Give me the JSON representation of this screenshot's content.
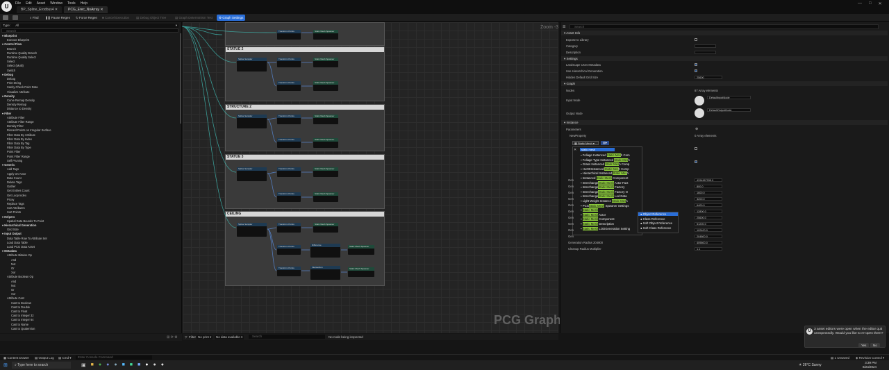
{
  "window": {
    "logo": "U",
    "menu": [
      "File",
      "Edit",
      "Asset",
      "Window",
      "Tools",
      "Help"
    ],
    "tabs": [
      "BP_Spline_Erodbus4",
      "PCG_Erec_NoArray"
    ],
    "window_controls": [
      "—",
      "□",
      "✕"
    ]
  },
  "toolbar": {
    "buttons": [
      "Find",
      "Pause Regen",
      "Force Regen",
      "Cancel Execution",
      "Debug Object Tree",
      "Graph Determinism Test"
    ],
    "graph_settings": "Graph Settings"
  },
  "palette": {
    "type_label": "Type",
    "type_value": "All",
    "search_placeholder": "Search",
    "tree": [
      {
        "t": "Blueprint",
        "l": 0
      },
      {
        "t": "Execute Blueprint",
        "l": 1
      },
      {
        "t": "Control Flow",
        "l": 0
      },
      {
        "t": "Branch",
        "l": 1
      },
      {
        "t": "Runtime Quality Branch",
        "l": 1
      },
      {
        "t": "Runtime Quality Select",
        "l": 1
      },
      {
        "t": "Select",
        "l": 1
      },
      {
        "t": "Select (Multi)",
        "l": 1
      },
      {
        "t": "Switch",
        "l": 1
      },
      {
        "t": "Debug",
        "l": 0
      },
      {
        "t": "Debug",
        "l": 1
      },
      {
        "t": "Print String",
        "l": 1
      },
      {
        "t": "Sanity Check Point Data",
        "l": 1
      },
      {
        "t": "Visualize Attribute",
        "l": 1
      },
      {
        "t": "Density",
        "l": 0
      },
      {
        "t": "Curve Remap Density",
        "l": 1
      },
      {
        "t": "Density Remap",
        "l": 1
      },
      {
        "t": "Distance to Density",
        "l": 1
      },
      {
        "t": "Filter",
        "l": 0
      },
      {
        "t": "Attribute Filter",
        "l": 1
      },
      {
        "t": "Attribute Filter Range",
        "l": 1
      },
      {
        "t": "Density Filter",
        "l": 1
      },
      {
        "t": "Discard Points on Irregular Surface",
        "l": 1
      },
      {
        "t": "Filter Data By Attribute",
        "l": 1
      },
      {
        "t": "Filter Data By Index",
        "l": 1
      },
      {
        "t": "Filter Data By Tag",
        "l": 1
      },
      {
        "t": "Filter Data By Type",
        "l": 1
      },
      {
        "t": "Point Filter",
        "l": 1
      },
      {
        "t": "Point Filter Range",
        "l": 1
      },
      {
        "t": "Self Pruning",
        "l": 1
      },
      {
        "t": "Generic",
        "l": 0
      },
      {
        "t": "Add Tags",
        "l": 1
      },
      {
        "t": "Apply On Actor",
        "l": 1
      },
      {
        "t": "Data Count",
        "l": 1
      },
      {
        "t": "Delete Tags",
        "l": 1
      },
      {
        "t": "Gather",
        "l": 1
      },
      {
        "t": "Get Entries Count",
        "l": 1
      },
      {
        "t": "Get Loop Index",
        "l": 1
      },
      {
        "t": "Proxy",
        "l": 1
      },
      {
        "t": "Replace Tags",
        "l": 1
      },
      {
        "t": "Sort Attributes",
        "l": 1
      },
      {
        "t": "Sort Points",
        "l": 1
      },
      {
        "t": "Helpers",
        "l": 0
      },
      {
        "t": "Spatial Data Bounds To Point",
        "l": 1
      },
      {
        "t": "Hierarchical Generation",
        "l": 0
      },
      {
        "t": "Grid Size",
        "l": 1
      },
      {
        "t": "Input Output",
        "l": 0
      },
      {
        "t": "Data Table Row To Attribute Set",
        "l": 1
      },
      {
        "t": "Load Data Table",
        "l": 1
      },
      {
        "t": "Load PCG Data Asset",
        "l": 1
      },
      {
        "t": "Metadata",
        "l": 0
      },
      {
        "t": "Attribute Bitwise Op",
        "l": 1
      },
      {
        "t": "And",
        "l": 2
      },
      {
        "t": "Not",
        "l": 2
      },
      {
        "t": "Or",
        "l": 2
      },
      {
        "t": "Xor",
        "l": 2
      },
      {
        "t": "Attribute Boolean Op",
        "l": 1
      },
      {
        "t": "And",
        "l": 2
      },
      {
        "t": "Not",
        "l": 2
      },
      {
        "t": "Or",
        "l": 2
      },
      {
        "t": "Xor",
        "l": 2
      },
      {
        "t": "Attribute Cast",
        "l": 1
      },
      {
        "t": "Cast to Boolean",
        "l": 2
      },
      {
        "t": "Cast to Double",
        "l": 2
      },
      {
        "t": "Cast to Float",
        "l": 2
      },
      {
        "t": "Cast to Integer 32",
        "l": 2
      },
      {
        "t": "Cast to Integer 64",
        "l": 2
      },
      {
        "t": "Cast to Name",
        "l": 2
      },
      {
        "t": "Cast to Quaternion",
        "l": 2
      }
    ]
  },
  "graph": {
    "zoom": "Zoom -3",
    "watermark": "PCG Graph",
    "comments": [
      "STATUE 2",
      "STRUCTURE 2",
      "STATUE 3",
      "CEILING"
    ],
    "node_titles": {
      "spline": "Spline Sampler",
      "transform": "Transform Points",
      "spawner": "Static Mesh Spawner",
      "spline_sub": "Spline",
      "sub2": "Ascending Shape",
      "diff": "Difference",
      "intersect": "Intersection"
    }
  },
  "graph_bottom": {
    "filter": "Filter",
    "print": "No print",
    "no_data": "No data available",
    "search_placeholder": "Search",
    "no_node": "No node being inspected"
  },
  "details": {
    "search_placeholder": "Search",
    "sections": {
      "asset_info": "Asset Info",
      "settings": "Settings",
      "graph": "Graph",
      "instance": "Instance"
    },
    "asset_info": [
      {
        "label": "Expose to Library",
        "value": ""
      },
      {
        "label": "Category",
        "value": ""
      },
      {
        "label": "Description",
        "value": ""
      }
    ],
    "settings": [
      {
        "label": "Landscape Uses Metadata",
        "value": ""
      },
      {
        "label": "Use Hierarchical Generation",
        "value": ""
      },
      {
        "label": "Hidden Default Grid Size",
        "value": "25600"
      }
    ],
    "graph": [
      {
        "label": "Nodes",
        "value": "87 Array elements"
      },
      {
        "label": "Input Node",
        "value": "DefaultInputNode"
      },
      {
        "label": "Output Node",
        "value": "DefaultOutputNode"
      }
    ],
    "instance": [
      {
        "label": "Parameters",
        "value": ""
      },
      {
        "label": "NewProperty",
        "value": "0 Array elements"
      }
    ],
    "picker": {
      "label": "Static Mesh",
      "search": "static mesh"
    },
    "numeric": [
      {
        "label": "Gen",
        "value": "4294967295.0"
      },
      {
        "label": "Gen",
        "value": "800.0"
      },
      {
        "label": "Gen",
        "value": "1600.0"
      },
      {
        "label": "Gen",
        "value": "3200.0"
      },
      {
        "label": "Gen",
        "value": "6400.0"
      },
      {
        "label": "Gen",
        "value": "12800.0"
      },
      {
        "label": "Gen",
        "value": "25600.0"
      },
      {
        "label": "Gen",
        "value": "51200.0"
      },
      {
        "label": "Gen",
        "value": "102400.0"
      },
      {
        "label": "Gen",
        "value": "204800.0"
      },
      {
        "label": "Generation Radius 204800",
        "value": "409600.0"
      },
      {
        "label": "Cleanup Radius Multiplier",
        "value": "1.1"
      }
    ]
  },
  "type_popup": {
    "items": [
      {
        "pre": "Foliage Instanced ",
        "hl": "Static Mes",
        "post": "h Com"
      },
      {
        "pre": "Foliage Type Instanced ",
        "hl": "Static Mes",
        "post": "h"
      },
      {
        "pre": "Grass Instanced ",
        "hl": "Static Mes",
        "post": "h Comp"
      },
      {
        "pre": "HLODInstanced ",
        "hl": "Static Mes",
        "post": "h Comp"
      },
      {
        "pre": "Hierarchical Instanced ",
        "hl": "Static Mes",
        "post": "h"
      },
      {
        "pre": "Instanced ",
        "hl": "Static Mesh",
        "post": " Component"
      },
      {
        "pre": "Interchange",
        "hl": "Static Mesh",
        "post": " Actor Fact"
      },
      {
        "pre": "Interchange",
        "hl": "Static Mesh",
        "post": " Factory"
      },
      {
        "pre": "Interchange",
        "hl": "Static Mesh",
        "post": " Factory N"
      },
      {
        "pre": "Interchange",
        "hl": "Static Mesh",
        "post": " Lod Data"
      },
      {
        "pre": "Light Weight Instance ",
        "hl": "Static Mes",
        "post": "h"
      },
      {
        "pre": "PCG",
        "hl": "Static Mesh",
        "post": " Spawner Settings"
      },
      {
        "pre": "",
        "hl": "Static Mesh",
        "post": ""
      },
      {
        "pre": "",
        "hl": "Static Mesh",
        "post": " Actor"
      },
      {
        "pre": "",
        "hl": "Static Mesh",
        "post": " Component"
      },
      {
        "pre": "",
        "hl": "Static Mesh",
        "post": " Description"
      },
      {
        "pre": "",
        "hl": "Static Mesh",
        "post": " LODGeneration Setting"
      }
    ],
    "submenu": [
      "Object Reference",
      "Class Reference",
      "Soft Object Reference",
      "Soft Class Reference"
    ]
  },
  "bottom": {
    "content_drawer": "Content Drawer",
    "output_log": "Output Log",
    "cmd": "Cmd",
    "console_placeholder": "Enter Console Command",
    "unsaved": "1 Unsaved",
    "revision": "Revision Control"
  },
  "toast": {
    "message": "3 asset editors were open when the editor quit unexpectedly. Would you like to re-open them?",
    "yes": "Yes",
    "no": "No"
  },
  "taskbar": {
    "search": "Type here to search",
    "weather": "26°C",
    "weather_desc": "Sunny",
    "time": "3:39 PM",
    "date": "8/23/2024"
  }
}
